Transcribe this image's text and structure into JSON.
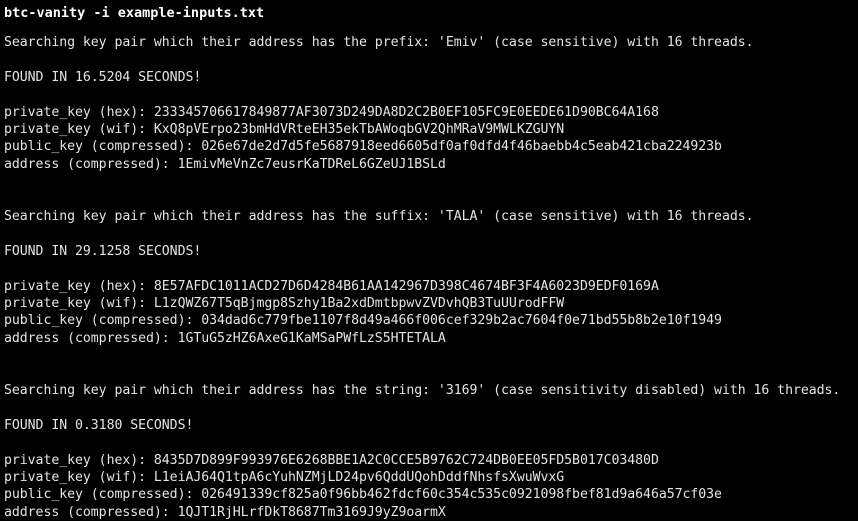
{
  "terminal": {
    "colors": {
      "background": "#000000",
      "foreground": "#e4e4e4",
      "prompt_foreground": "#ffffff"
    },
    "command": "btc-vanity -i example-inputs.txt",
    "blocks": [
      {
        "search": "Searching key pair which their address has the prefix: 'Emiv' (case sensitive) with 16 threads.",
        "found": "FOUND IN 16.5204 SECONDS!",
        "results": [
          "private_key (hex): 233345706617849877AF3073D249DA8D2C2B0EF105FC9E0EEDE61D90BC64A168",
          "private_key (wif): KxQ8pVErpo23bmHdVRteEH35ekTbAWoqbGV2QhMRaV9MWLKZGUYN",
          "public_key (compressed): 026e67de2d7d5fe5687918eed6605df0af0dfd4f46baebb4c5eab421cba224923b",
          "address (compressed): 1EmivMeVnZc7eusrKaTDReL6GZeUJ1BSLd"
        ]
      },
      {
        "search": "Searching key pair which their address has the suffix: 'TALA' (case sensitive) with 16 threads.",
        "found": "FOUND IN 29.1258 SECONDS!",
        "results": [
          "private_key (hex): 8E57AFDC1011ACD27D6D4284B61AA142967D398C4674BF3F4A6023D9EDF0169A",
          "private_key (wif): L1zQWZ67T5qBjmgp8Szhy1Ba2xdDmtbpwvZVDvhQB3TuUUrodFFW",
          "public_key (compressed): 034dad6c779fbe1107f8d49a466f006cef329b2ac7604f0e71bd55b8b2e10f1949",
          "address (compressed): 1GTuG5zHZ6AxeG1KaMSaPWfLzS5HTETALA"
        ]
      },
      {
        "search": "Searching key pair which their address has the string: '3169' (case sensitivity disabled) with 16 threads.",
        "found": "FOUND IN 0.3180 SECONDS!",
        "results": [
          "private_key (hex): 8435D7D899F993976E6268BBE1A2C0CCE5B9762C724DB0EE05FD5B017C03480D",
          "private_key (wif): L1eiAJ64Q1tpA6cYuhNZMjLD24pv6QddUQohDddfNhsfsXwuWvxG",
          "public_key (compressed): 026491339cf825a0f96bb462fdcf60c354c535c0921098fbef81d9a646a57cf03e",
          "address (compressed): 1QJT1RjHLrfDkT8687Tm3169J9yZ9oarmX"
        ]
      }
    ]
  }
}
